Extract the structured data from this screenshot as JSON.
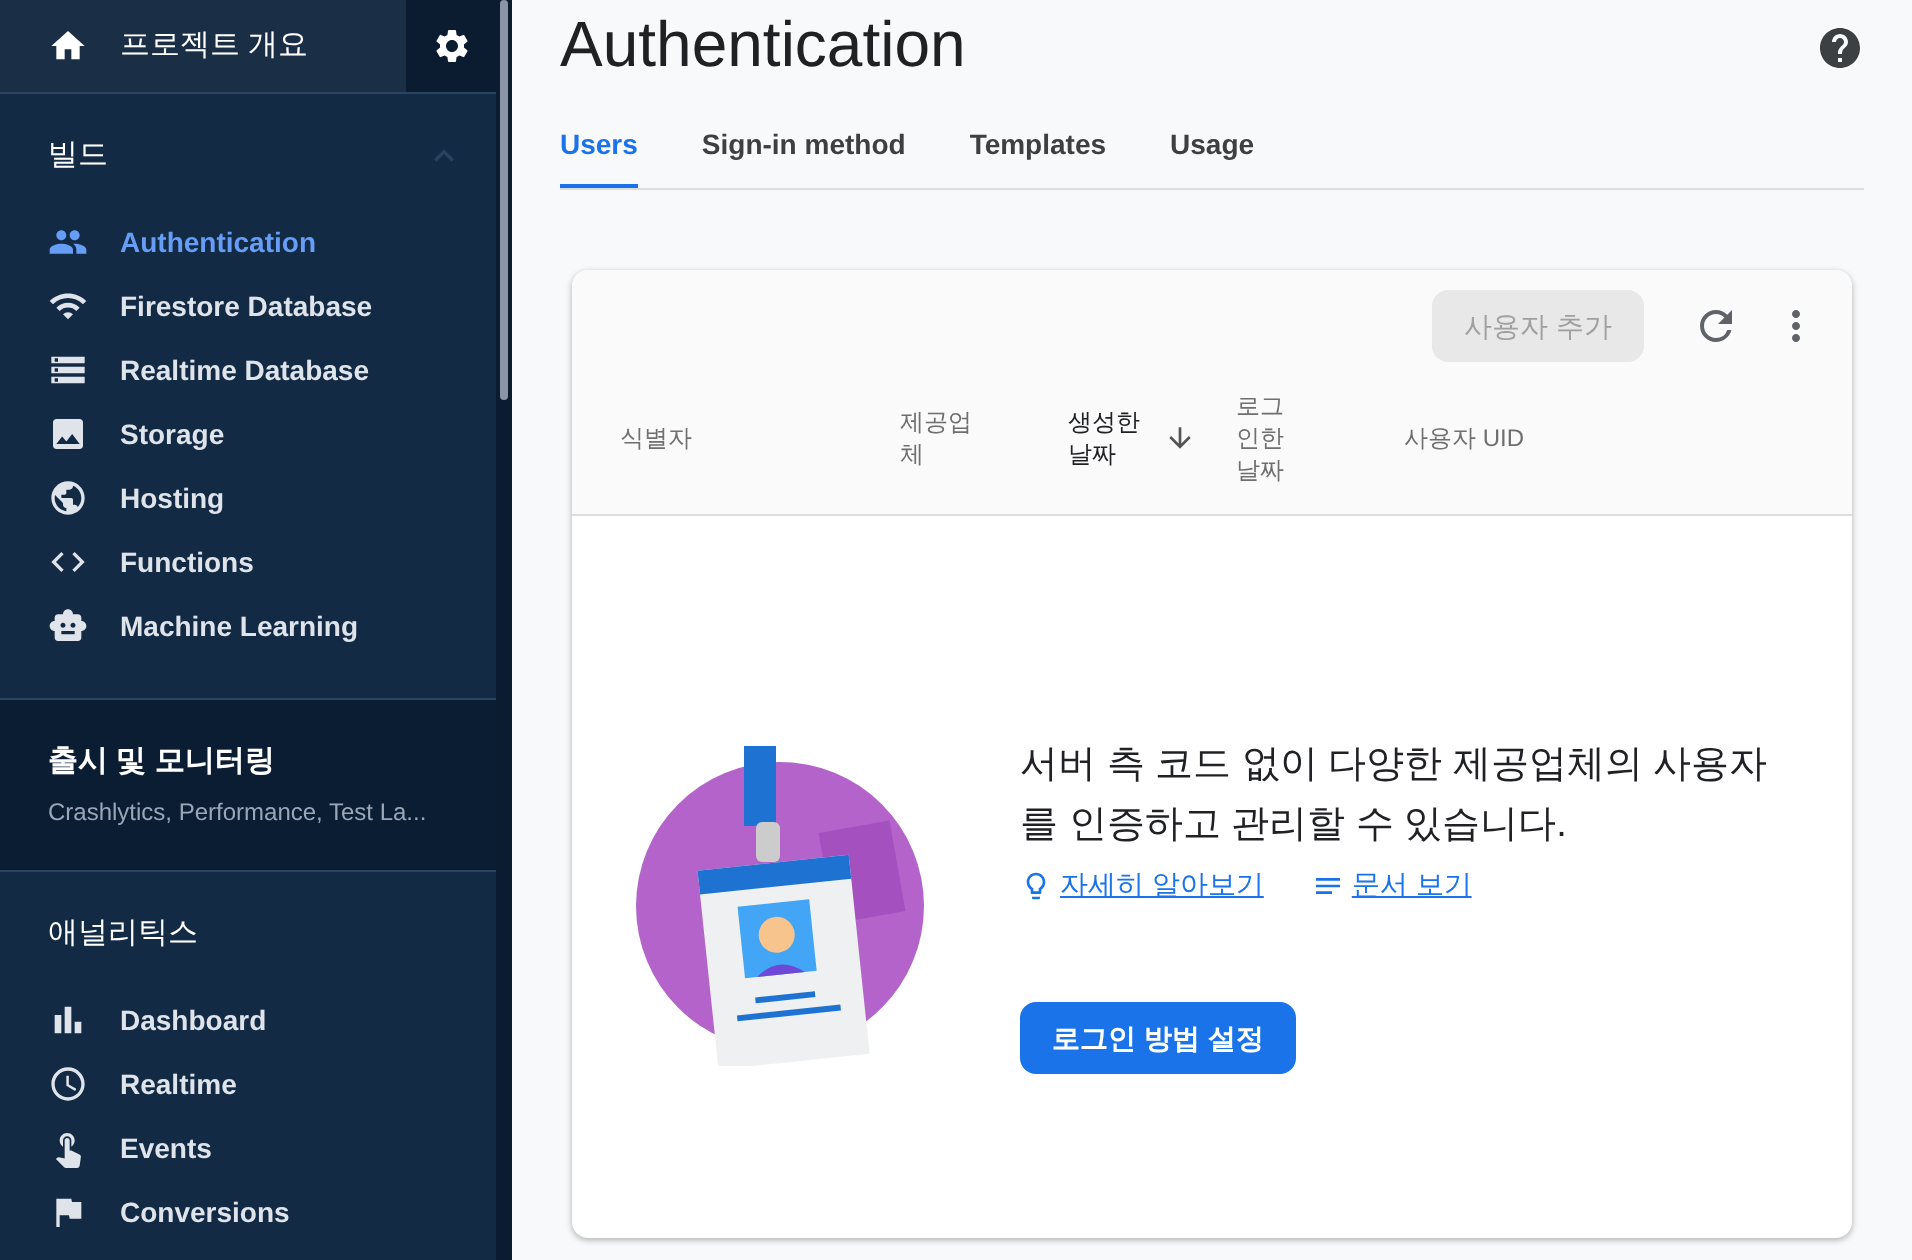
{
  "sidebar": {
    "overview": "프로젝트 개요",
    "sections": [
      {
        "kind": "group",
        "title": "빌드",
        "expanded": true,
        "items": [
          {
            "label": "Authentication",
            "selected": true
          },
          {
            "label": "Firestore Database",
            "selected": false
          },
          {
            "label": "Realtime Database",
            "selected": false
          },
          {
            "label": "Storage",
            "selected": false
          },
          {
            "label": "Hosting",
            "selected": false
          },
          {
            "label": "Functions",
            "selected": false
          },
          {
            "label": "Machine Learning",
            "selected": false
          }
        ]
      },
      {
        "kind": "collapsed",
        "title": "출시 및 모니터링",
        "subtitle": "Crashlytics, Performance, Test La..."
      },
      {
        "kind": "group",
        "title": "애널리틱스",
        "items": [
          {
            "label": "Dashboard",
            "selected": false
          },
          {
            "label": "Realtime",
            "selected": false
          },
          {
            "label": "Events",
            "selected": false
          },
          {
            "label": "Conversions",
            "selected": false
          }
        ]
      }
    ]
  },
  "page": {
    "title": "Authentication",
    "tabs": [
      {
        "label": "Users",
        "selected": true
      },
      {
        "label": "Sign-in method",
        "selected": false
      },
      {
        "label": "Templates",
        "selected": false
      },
      {
        "label": "Usage",
        "selected": false
      }
    ]
  },
  "card": {
    "add_user_button": {
      "label": "사용자 추가",
      "disabled": true
    },
    "columns": [
      {
        "label": "식별자",
        "sorted": false
      },
      {
        "label": "제공업체",
        "sorted": false
      },
      {
        "label": "생성한 날짜",
        "sorted": true
      },
      {
        "label": "로그인한 날짜",
        "sorted": false
      },
      {
        "label": "사용자 UID",
        "sorted": false
      }
    ],
    "empty_message": "서버 측 코드 없이 다양한 제공업체의 사용자를 인증하고 관리할 수 있습니다.",
    "links": [
      {
        "label": "자세히 알아보기"
      },
      {
        "label": "문서 보기"
      }
    ],
    "setup_button": "로그인 방법 설정"
  }
}
